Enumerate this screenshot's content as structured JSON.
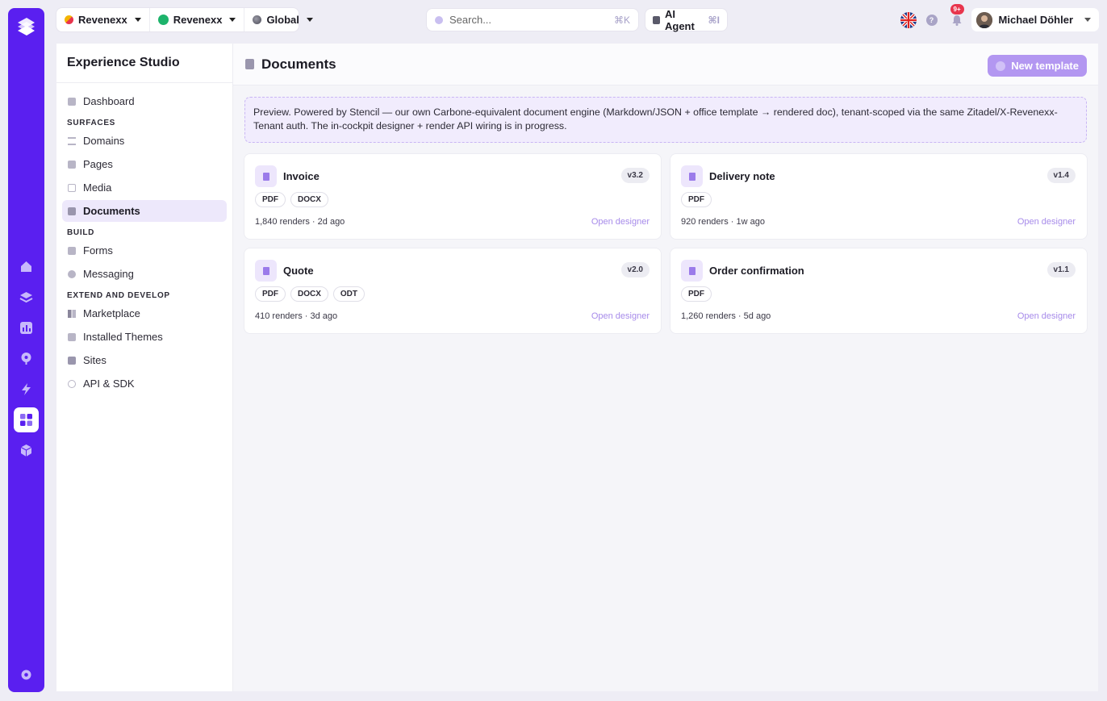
{
  "topbar": {
    "contexts": [
      {
        "label": "Revenexx",
        "icon": "revenexx-logo-icon",
        "color": "#f4b400"
      },
      {
        "label": "Revenexx",
        "icon": "status-dot-icon",
        "color": "#1db36b"
      },
      {
        "label": "Global",
        "icon": "globe-icon",
        "color": "#5a5a6a"
      }
    ],
    "search_placeholder": "Search...",
    "search_shortcut": "⌘K",
    "ai_agent_label": "AI Agent",
    "ai_agent_shortcut": "⌘I",
    "notification_badge": "9+",
    "user_name": "Michael Döhler"
  },
  "sidebar": {
    "title": "Experience Studio",
    "items": [
      {
        "type": "item",
        "label": "Dashboard",
        "icon": "dashboard-icon"
      },
      {
        "type": "section",
        "label": "SURFACES"
      },
      {
        "type": "item",
        "label": "Domains",
        "icon": "domains-icon"
      },
      {
        "type": "item",
        "label": "Pages",
        "icon": "pages-icon"
      },
      {
        "type": "item",
        "label": "Media",
        "icon": "media-icon"
      },
      {
        "type": "item",
        "label": "Documents",
        "icon": "documents-icon",
        "active": true
      },
      {
        "type": "section",
        "label": "BUILD"
      },
      {
        "type": "item",
        "label": "Forms",
        "icon": "forms-icon"
      },
      {
        "type": "item",
        "label": "Messaging",
        "icon": "messaging-icon"
      },
      {
        "type": "section",
        "label": "EXTEND AND DEVELOP"
      },
      {
        "type": "item",
        "label": "Marketplace",
        "icon": "marketplace-icon"
      },
      {
        "type": "item",
        "label": "Installed Themes",
        "icon": "themes-icon"
      },
      {
        "type": "item",
        "label": "Sites",
        "icon": "sites-icon"
      },
      {
        "type": "item",
        "label": "API & SDK",
        "icon": "api-icon"
      }
    ]
  },
  "main": {
    "title": "Documents",
    "new_button_label": "New template",
    "notice": "Preview. Powered by Stencil — our own Carbone-equivalent document engine (Markdown/JSON + office template → rendered doc), tenant-scoped via the same Zitadel/X-Revenexx-Tenant auth. The in-cockpit designer + render API wiring is in progress.",
    "open_designer_label": "Open designer",
    "templates": [
      {
        "name": "Invoice",
        "version": "v3.2",
        "formats": [
          "PDF",
          "DOCX"
        ],
        "stats": "1,840 renders · 2d ago"
      },
      {
        "name": "Delivery note",
        "version": "v1.4",
        "formats": [
          "PDF"
        ],
        "stats": "920 renders · 1w ago"
      },
      {
        "name": "Quote",
        "version": "v2.0",
        "formats": [
          "PDF",
          "DOCX",
          "ODT"
        ],
        "stats": "410 renders · 3d ago"
      },
      {
        "name": "Order confirmation",
        "version": "v1.1",
        "formats": [
          "PDF"
        ],
        "stats": "1,260 renders · 5d ago"
      }
    ]
  },
  "colors": {
    "brand": "#5a1ff0",
    "accent_light": "#b397f1",
    "link": "#a78bea"
  }
}
